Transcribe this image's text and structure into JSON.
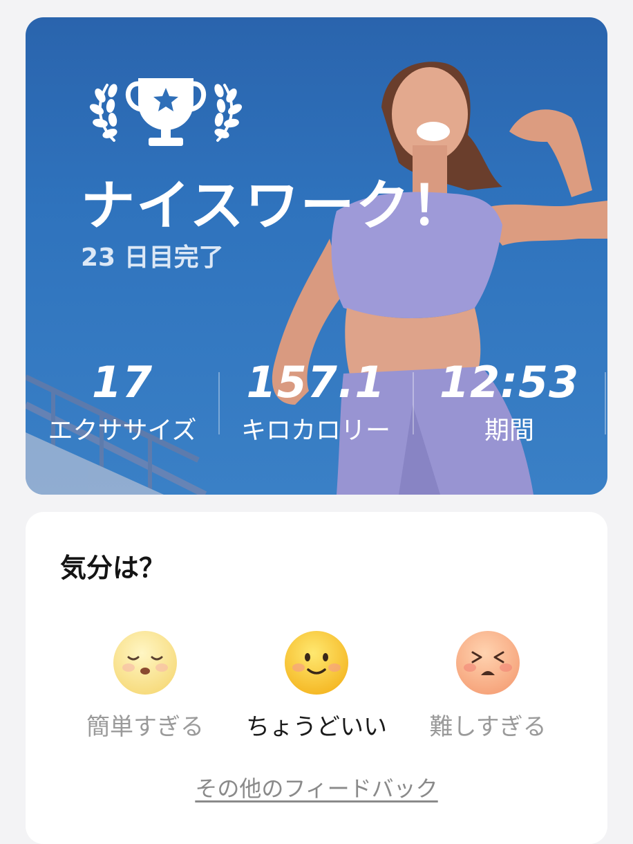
{
  "hero": {
    "title": "ナイスワーク！",
    "subtitle": "23 日目完了",
    "stats": [
      {
        "value": "17",
        "label": "エクササイズ"
      },
      {
        "value": "157.1",
        "label": "キロカロリー"
      },
      {
        "value": "12:53",
        "label": "期間"
      }
    ],
    "icons": {
      "trophy": "trophy-star-icon",
      "laurel_left": "laurel-left-icon",
      "laurel_right": "laurel-right-icon"
    },
    "colors": {
      "background": "#2f6fb8",
      "outfit": "#9a96d8"
    }
  },
  "mood": {
    "title": "気分は？",
    "options": [
      {
        "label": "簡単すぎる",
        "icon": "sleepy-face-icon",
        "selected": false
      },
      {
        "label": "ちょうどいい",
        "icon": "smiling-face-icon",
        "selected": true
      },
      {
        "label": "難しすぎる",
        "icon": "frustrated-face-icon",
        "selected": false
      }
    ],
    "feedback_link": "その他のフィードバック"
  }
}
